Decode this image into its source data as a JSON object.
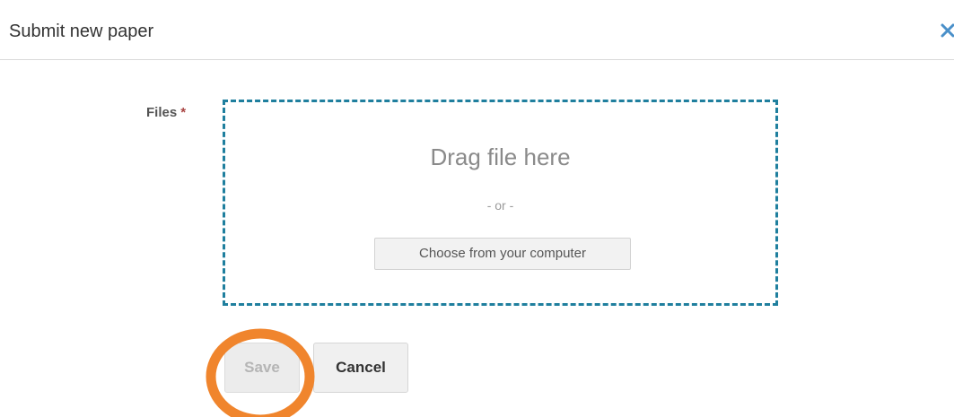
{
  "modal": {
    "title": "Submit new paper",
    "close_icon": "close-icon"
  },
  "form": {
    "files_label": "Files",
    "required_marker": "*",
    "dropzone": {
      "drag_text": "Drag file here",
      "or_text": "- or -",
      "choose_label": "Choose from your computer"
    },
    "actions": {
      "save_label": "Save",
      "save_disabled": true,
      "cancel_label": "Cancel"
    }
  },
  "colors": {
    "dropzone_border": "#1f7f9e",
    "required_star": "#a94442",
    "close_icon": "#4a90c9",
    "highlight_ring": "#f0852d"
  }
}
